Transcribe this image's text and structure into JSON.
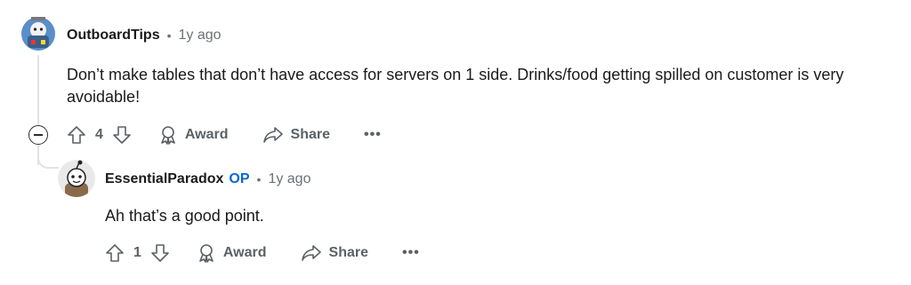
{
  "comment": {
    "username": "OutboardTips",
    "separator": "•",
    "time": "1y ago",
    "body": "Don’t make tables that don’t have access for servers on 1 side. Drinks/food getting spilled on customer is very avoidable!",
    "score": "4",
    "award_label": "Award",
    "share_label": "Share",
    "more_label": "•••"
  },
  "reply": {
    "username": "EssentialParadox",
    "op_badge": "OP",
    "separator": "•",
    "time": "1y ago",
    "body": "Ah that’s a good point.",
    "score": "1",
    "award_label": "Award",
    "share_label": "Share",
    "more_label": "•••"
  },
  "icons": {
    "upvote": "arrow-up-outline",
    "downvote": "arrow-down-outline",
    "award": "award-ribbon",
    "share": "share-arrow",
    "collapse": "minus-circle"
  }
}
